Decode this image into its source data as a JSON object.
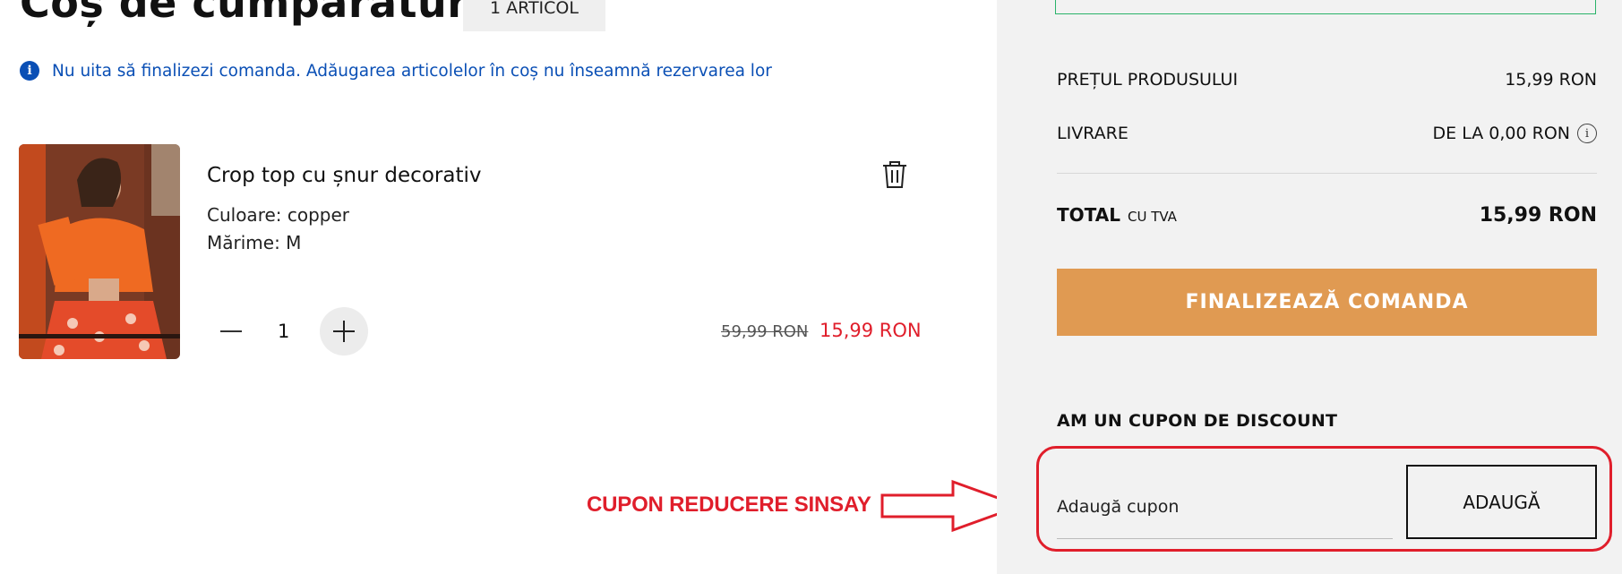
{
  "cart": {
    "title": "Coș de cumpărături",
    "item_count": "1 ARTICOL",
    "notice": "Nu uita să finalizezi comanda. Adăugarea articolelor în coș nu înseamnă rezervarea lor",
    "notice_icon": "i"
  },
  "item": {
    "name": "Crop top cu șnur decorativ",
    "color": "Culoare: copper",
    "size": "Mărime: M",
    "quantity": "1",
    "old_price": "59,99 RON",
    "price": "15,99 RON"
  },
  "summary": {
    "product_price_label": "PREȚUL PRODUSULUI",
    "product_price_value": "15,99 RON",
    "delivery_label": "LIVRARE",
    "delivery_value": "DE LA 0,00 RON",
    "delivery_info_icon": "i",
    "total_label": "TOTAL",
    "total_sub": "CU TVA",
    "total_value": "15,99 RON",
    "checkout_label": "FINALIZEAZĂ COMANDA"
  },
  "coupon": {
    "heading": "AM UN CUPON DE DISCOUNT",
    "placeholder": "Adaugă cupon",
    "button_label": "ADAUGĂ"
  },
  "annotation": {
    "label": "CUPON REDUCERE SINSAY"
  },
  "colors": {
    "accent_orange": "#e09a52",
    "sale_red": "#e01e2b",
    "info_blue": "#0a4fb5",
    "summary_bg": "#f2f2f2"
  }
}
